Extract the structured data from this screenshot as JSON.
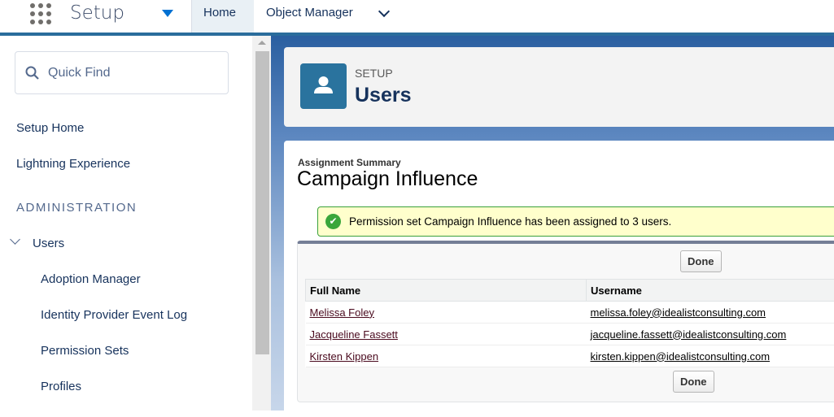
{
  "app": {
    "name": "Setup",
    "tabs": [
      {
        "label": "Home"
      },
      {
        "label": "Object Manager"
      }
    ]
  },
  "sidebar": {
    "search_placeholder": "Quick Find",
    "items": [
      {
        "label": "Setup Home"
      },
      {
        "label": "Lightning Experience"
      }
    ],
    "section": "ADMINISTRATION",
    "group": "Users",
    "subitems": [
      {
        "label": "Adoption Manager"
      },
      {
        "label": "Identity Provider Event Log"
      },
      {
        "label": "Permission Sets"
      },
      {
        "label": "Profiles"
      }
    ]
  },
  "header": {
    "eyebrow": "SETUP",
    "title": "Users",
    "icon": "user-icon"
  },
  "content": {
    "subtitle": "Assignment Summary",
    "title": "Campaign Influence",
    "message": "Permission set Campaign Influence has been assigned to 3 users.",
    "done_label": "Done",
    "table": {
      "columns": [
        "Full Name",
        "Username"
      ],
      "rows": [
        [
          "Melissa Foley",
          "melissa.foley@idealistconsulting.com"
        ],
        [
          "Jacqueline Fassett",
          "jacqueline.fassett@idealistconsulting.com"
        ],
        [
          "Kirsten Kippen",
          "kirsten.kippen@idealistconsulting.com"
        ]
      ]
    }
  },
  "colors": {
    "brand": "#2a6d9c",
    "success": "#3aa63b",
    "message_bg": "#ffffcc"
  }
}
